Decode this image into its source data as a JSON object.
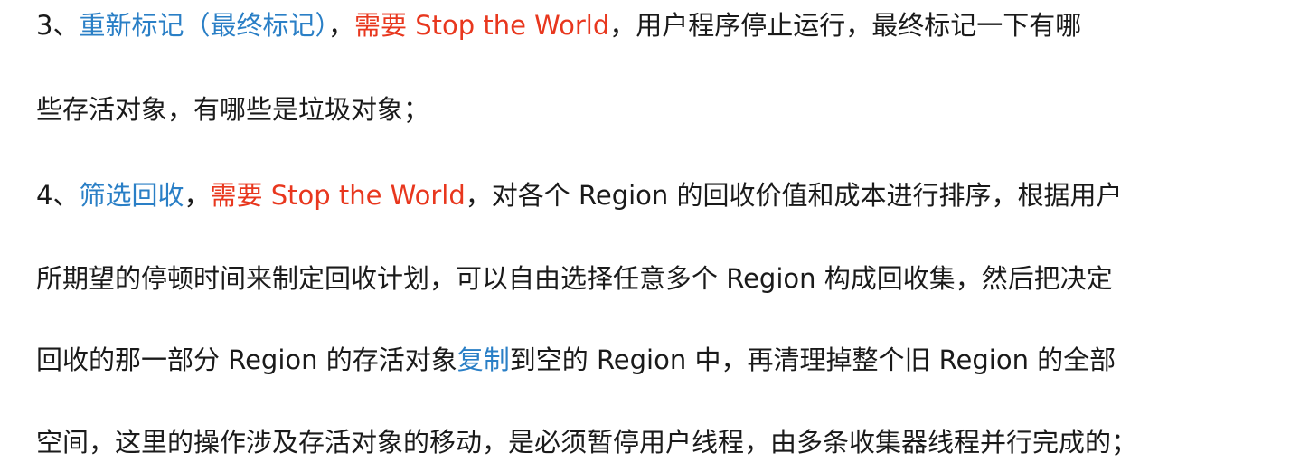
{
  "paragraphs": [
    {
      "lines": [
        [
          {
            "text": "3、",
            "style": "normal"
          },
          {
            "text": "重新标记（最终标记）",
            "style": "blue"
          },
          {
            "text": "，",
            "style": "normal"
          },
          {
            "text": "需要 Stop the World",
            "style": "red"
          },
          {
            "text": "，用户程序停止运行，最终标记一下有哪",
            "style": "normal"
          }
        ],
        [
          {
            "text": "些存活对象，有哪些是垃圾对象；",
            "style": "normal"
          }
        ]
      ]
    },
    {
      "lines": [
        [
          {
            "text": "4、",
            "style": "normal"
          },
          {
            "text": "筛选回收",
            "style": "blue"
          },
          {
            "text": "，",
            "style": "normal"
          },
          {
            "text": "需要 Stop the World",
            "style": "red"
          },
          {
            "text": "，对各个 Region 的回收价值和成本进行排序，根据用户",
            "style": "normal"
          }
        ],
        [
          {
            "text": "所期望的停顿时间来制定回收计划，可以自由选择任意多个 Region 构成回收集，然后把决定",
            "style": "normal"
          }
        ],
        [
          {
            "text": "回收的那一部分 Region 的存活对象",
            "style": "normal"
          },
          {
            "text": "复制",
            "style": "blue"
          },
          {
            "text": "到空的 Region 中，再清理掉整个旧 Region 的全部",
            "style": "normal"
          }
        ],
        [
          {
            "text": "空间，这里的操作涉及存活对象的移动，是必须暂停用户线程，由多条收集器线程并行完成的；",
            "style": "normal"
          }
        ]
      ]
    }
  ],
  "colors": {
    "text": "#1a1a1a",
    "highlight_blue": "#2a7fc6",
    "highlight_red": "#e8371e"
  }
}
